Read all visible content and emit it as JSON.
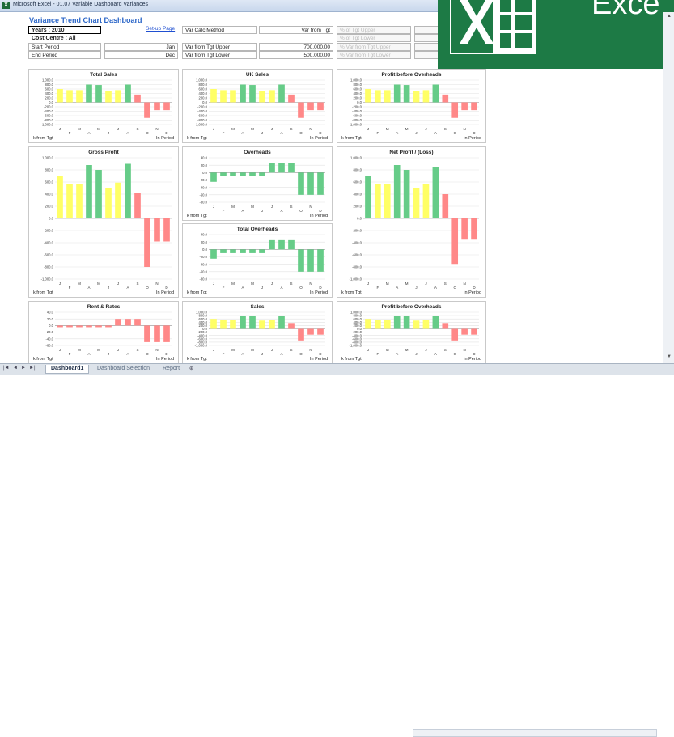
{
  "window": {
    "title": "Microsoft Excel - 01.07 Variable Dashboard Variances",
    "app_icon": "X"
  },
  "logo": {
    "text": "Exce"
  },
  "dashboard": {
    "title": "Variance Trend Chart Dashboard",
    "setup_link": "Set-up Page"
  },
  "cells": {
    "years": "Years : 2010",
    "cost_centre": "Cost Centre : All",
    "start_period_label": "Start Period",
    "start_period_value": "Jan",
    "end_period_label": "End Period",
    "end_period_value": "Dec",
    "var_calc_label": "Var Calc Method",
    "var_calc_value": "Var from Tgt",
    "tgt_upper_label": "Var from Tgt Upper",
    "tgt_upper_value": "700,000.00",
    "tgt_lower_label": "Var from Tgt Lower",
    "tgt_lower_value": "500,000.00",
    "pct_upper_1": "% of Tgt Upper",
    "pct_lower_1": "% of Tgt Lower",
    "pct_upper_2": "% Var from Tgt Upper",
    "pct_lower_2": "% Var from Tgt Lower"
  },
  "colors": {
    "green": "#66cc88",
    "yellow": "#ffff66",
    "red": "#ff8888"
  },
  "footer": {
    "left": "k from Tgt",
    "right": "In Period"
  },
  "months_top": [
    "J",
    "M",
    "M",
    "J",
    "S",
    "N"
  ],
  "months_bottom": [
    "F",
    "A",
    "J",
    "A",
    "O",
    "D"
  ],
  "chart_data": [
    {
      "type": "bar",
      "title": "Total Sales",
      "ylim": [
        -1000,
        1000
      ],
      "ticks": [
        "1,000.0",
        "800.0",
        "600.0",
        "400.0",
        "200.0",
        "0.0",
        "-200.0",
        "-400.0",
        "-600.0",
        "-800.0",
        "-1,000.0"
      ],
      "categories": [
        "J",
        "F",
        "M",
        "A",
        "M",
        "J",
        "J",
        "A",
        "S",
        "O",
        "N",
        "D"
      ],
      "values": [
        600,
        550,
        550,
        800,
        780,
        500,
        550,
        800,
        350,
        -700,
        -350,
        -350
      ],
      "colors": [
        "yellow",
        "yellow",
        "yellow",
        "green",
        "green",
        "yellow",
        "yellow",
        "green",
        "red",
        "red",
        "red",
        "red"
      ]
    },
    {
      "type": "bar",
      "title": "UK Sales",
      "ylim": [
        -1000,
        1000
      ],
      "ticks": [
        "1,000.0",
        "800.0",
        "600.0",
        "400.0",
        "200.0",
        "0.0",
        "-200.0",
        "-400.0",
        "-600.0",
        "-800.0",
        "-1,000.0"
      ],
      "categories": [
        "J",
        "F",
        "M",
        "A",
        "M",
        "J",
        "J",
        "A",
        "S",
        "O",
        "N",
        "D"
      ],
      "values": [
        600,
        550,
        550,
        800,
        780,
        500,
        550,
        800,
        350,
        -700,
        -350,
        -350
      ],
      "colors": [
        "yellow",
        "yellow",
        "yellow",
        "green",
        "green",
        "yellow",
        "yellow",
        "green",
        "red",
        "red",
        "red",
        "red"
      ]
    },
    {
      "type": "bar",
      "title": "Profit before Overheads",
      "ylim": [
        -1000,
        1000
      ],
      "ticks": [
        "1,000.0",
        "800.0",
        "600.0",
        "400.0",
        "200.0",
        "0.0",
        "-200.0",
        "-400.0",
        "-600.0",
        "-800.0",
        "-1,000.0"
      ],
      "categories": [
        "J",
        "F",
        "M",
        "A",
        "M",
        "J",
        "J",
        "A",
        "S",
        "O",
        "N",
        "D"
      ],
      "values": [
        600,
        550,
        550,
        800,
        780,
        500,
        550,
        800,
        350,
        -700,
        -350,
        -350
      ],
      "colors": [
        "yellow",
        "yellow",
        "yellow",
        "green",
        "green",
        "yellow",
        "yellow",
        "green",
        "red",
        "red",
        "red",
        "red"
      ]
    },
    {
      "type": "bar",
      "title": "Gross Profit",
      "ylim": [
        -1000,
        1000
      ],
      "ticks": [
        "1,000.0",
        "800.0",
        "600.0",
        "400.0",
        "200.0",
        "0.0",
        "-200.0",
        "-400.0",
        "-600.0",
        "-800.0",
        "-1,000.0"
      ],
      "categories": [
        "J",
        "F",
        "M",
        "A",
        "M",
        "J",
        "J",
        "A",
        "S",
        "O",
        "N",
        "D"
      ],
      "values": [
        700,
        560,
        560,
        880,
        800,
        500,
        590,
        900,
        420,
        -800,
        -380,
        -380
      ],
      "colors": [
        "yellow",
        "yellow",
        "yellow",
        "green",
        "green",
        "yellow",
        "yellow",
        "green",
        "red",
        "red",
        "red",
        "red"
      ]
    },
    {
      "type": "bar",
      "title": "Overheads",
      "ylim": [
        -80,
        40
      ],
      "ticks": [
        "40.0",
        "20.0",
        "0.0",
        "-20.0",
        "-40.0",
        "-60.0",
        "-80.0"
      ],
      "categories": [
        "J",
        "F",
        "M",
        "A",
        "M",
        "J",
        "J",
        "A",
        "S",
        "O",
        "N",
        "D"
      ],
      "values": [
        -25,
        -10,
        -10,
        -10,
        -10,
        -10,
        25,
        25,
        25,
        -60,
        -60,
        -60
      ],
      "colors": [
        "green",
        "green",
        "green",
        "green",
        "green",
        "green",
        "green",
        "green",
        "green",
        "green",
        "green",
        "green"
      ]
    },
    {
      "type": "bar",
      "title": "Total Overheads",
      "ylim": [
        -80,
        40
      ],
      "ticks": [
        "40.0",
        "20.0",
        "0.0",
        "-20.0",
        "-40.0",
        "-60.0",
        "-80.0"
      ],
      "categories": [
        "J",
        "F",
        "M",
        "A",
        "M",
        "J",
        "J",
        "A",
        "S",
        "O",
        "N",
        "D"
      ],
      "values": [
        -25,
        -10,
        -10,
        -10,
        -10,
        -10,
        25,
        25,
        25,
        -60,
        -60,
        -60
      ],
      "colors": [
        "green",
        "green",
        "green",
        "green",
        "green",
        "green",
        "green",
        "green",
        "green",
        "green",
        "green",
        "green"
      ]
    },
    {
      "type": "bar",
      "title": "Net Profit / (Loss)",
      "ylim": [
        -1000,
        1000
      ],
      "ticks": [
        "1,000.0",
        "800.0",
        "600.0",
        "400.0",
        "200.0",
        "0.0",
        "-200.0",
        "-400.0",
        "-600.0",
        "-800.0",
        "-1,000.0"
      ],
      "categories": [
        "J",
        "F",
        "M",
        "A",
        "M",
        "J",
        "J",
        "A",
        "S",
        "O",
        "N",
        "D"
      ],
      "values": [
        700,
        560,
        560,
        880,
        800,
        500,
        560,
        850,
        400,
        -750,
        -350,
        -350
      ],
      "colors": [
        "green",
        "yellow",
        "yellow",
        "green",
        "green",
        "yellow",
        "yellow",
        "green",
        "red",
        "red",
        "red",
        "red"
      ]
    },
    {
      "type": "bar",
      "title": "Rent & Rates",
      "ylim": [
        -60,
        40
      ],
      "ticks": [
        "40.0",
        "20.0",
        "0.0",
        "-20.0",
        "-40.0",
        "-60.0"
      ],
      "categories": [
        "J",
        "F",
        "M",
        "A",
        "M",
        "J",
        "J",
        "A",
        "S",
        "O",
        "N",
        "D"
      ],
      "values": [
        -5,
        -5,
        -5,
        -5,
        -5,
        -5,
        20,
        20,
        20,
        -50,
        -50,
        -50
      ],
      "colors": [
        "red",
        "red",
        "red",
        "red",
        "red",
        "red",
        "red",
        "red",
        "red",
        "red",
        "red",
        "red"
      ]
    },
    {
      "type": "bar",
      "title": "Sales",
      "ylim": [
        -1000,
        1000
      ],
      "ticks": [
        "1,000.0",
        "800.0",
        "600.0",
        "400.0",
        "200.0",
        "0.0",
        "-200.0",
        "-400.0",
        "-600.0",
        "-800.0",
        "-1,000.0"
      ],
      "categories": [
        "J",
        "F",
        "M",
        "A",
        "M",
        "J",
        "J",
        "A",
        "S",
        "O",
        "N",
        "D"
      ],
      "values": [
        600,
        550,
        550,
        800,
        780,
        500,
        550,
        800,
        350,
        -700,
        -350,
        -350
      ],
      "colors": [
        "yellow",
        "yellow",
        "yellow",
        "green",
        "green",
        "yellow",
        "yellow",
        "green",
        "red",
        "red",
        "red",
        "red"
      ]
    },
    {
      "type": "bar",
      "title": "Profit before Overheads",
      "ylim": [
        -1000,
        1000
      ],
      "ticks": [
        "1,000.0",
        "800.0",
        "600.0",
        "400.0",
        "200.0",
        "0.0",
        "-200.0",
        "-400.0",
        "-600.0",
        "-800.0",
        "-1,000.0"
      ],
      "categories": [
        "J",
        "F",
        "M",
        "A",
        "M",
        "J",
        "J",
        "A",
        "S",
        "O",
        "N",
        "D"
      ],
      "values": [
        600,
        550,
        550,
        800,
        780,
        500,
        550,
        800,
        350,
        -700,
        -350,
        -350
      ],
      "colors": [
        "yellow",
        "yellow",
        "yellow",
        "green",
        "green",
        "yellow",
        "yellow",
        "green",
        "red",
        "red",
        "red",
        "red"
      ]
    }
  ],
  "tabs": [
    {
      "label": "Dashboard1"
    },
    {
      "label": "Dashboard Selection"
    },
    {
      "label": "Report"
    }
  ]
}
